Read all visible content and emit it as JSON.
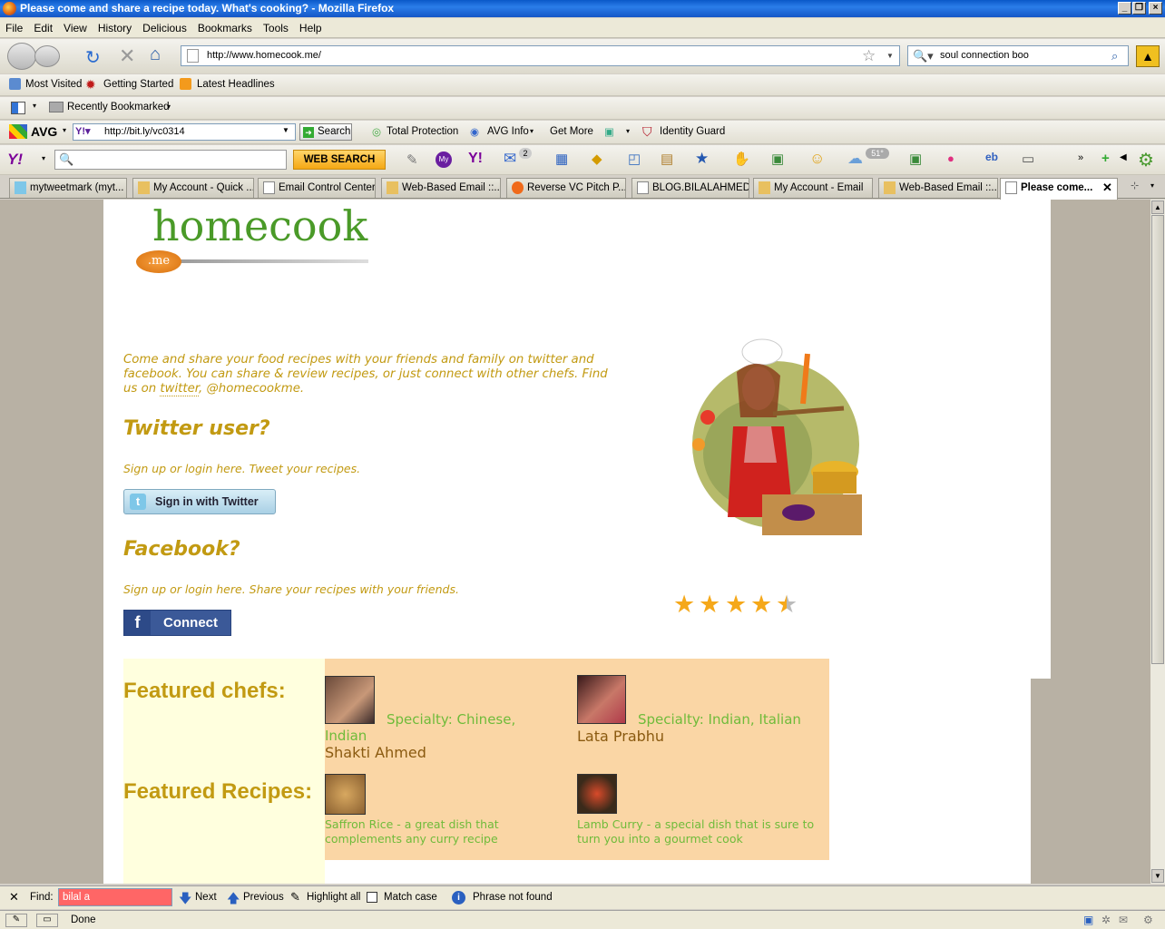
{
  "window": {
    "title": "Please come and share a recipe today. What's cooking? - Mozilla Firefox"
  },
  "menu": [
    "File",
    "Edit",
    "View",
    "History",
    "Delicious",
    "Bookmarks",
    "Tools",
    "Help"
  ],
  "nav": {
    "url": "http://www.homecook.me/",
    "search_value": "soul connection boo"
  },
  "bookmarks": {
    "most_visited": "Most Visited",
    "getting_started": "Getting Started",
    "latest_headlines": "Latest Headlines",
    "recently_bookmarked": "Recently Bookmarked"
  },
  "avg": {
    "brand": "AVG",
    "url": "http://bit.ly/vc0314",
    "search": "Search",
    "total_protection": "Total Protection",
    "avg_info": "AVG Info",
    "get_more": "Get More",
    "identity_guard": "Identity Guard"
  },
  "yahoo": {
    "logo": "Y!",
    "web_search": "WEB SEARCH",
    "mail_count": "2",
    "weather": "51°"
  },
  "tabs": [
    "mytweetmark (myt...",
    "My Account - Quick ...",
    "Email Control Center",
    "Web-Based Email ::...",
    "Reverse VC Pitch P...",
    "BLOG.BILALAHMED...",
    "My Account - Email",
    "Web-Based Email ::...",
    "Please come..."
  ],
  "page": {
    "logo_text": "homecook",
    "logo_badge": ".me",
    "intro_a": "Come and share your food recipes with your friends and family on twitter and facebook. You can share & review recipes, or just connect with other chefs. Find us on ",
    "intro_link": "twitter",
    "intro_b": ", @homecookme.",
    "twitter_heading": "Twitter user?",
    "twitter_sub": "Sign up or login here. Tweet your recipes.",
    "twitter_button": "Sign in with Twitter",
    "facebook_heading": "Facebook?",
    "facebook_sub": "Sign up or login here. Share your recipes with your friends.",
    "facebook_button": "Connect",
    "rating": 4.5,
    "featured_chefs_label": "Featured chefs:",
    "chefs": [
      {
        "specialty": "Specialty: Chinese, Indian",
        "name": "Shakti Ahmed"
      },
      {
        "specialty": "Specialty: Indian, Italian",
        "name": "Lata Prabhu"
      }
    ],
    "featured_recipes_label": "Featured Recipes:",
    "recipes": [
      {
        "text": "Saffron Rice - a great dish that complements any curry recipe"
      },
      {
        "text": "Lamb Curry - a special dish that is sure to turn you into a gourmet cook"
      }
    ]
  },
  "findbar": {
    "label": "Find:",
    "value": "bilal a",
    "next": "Next",
    "previous": "Previous",
    "highlight_all": "Highlight all",
    "match_case": "Match case",
    "status": "Phrase not found"
  },
  "status": {
    "text": "Done"
  }
}
